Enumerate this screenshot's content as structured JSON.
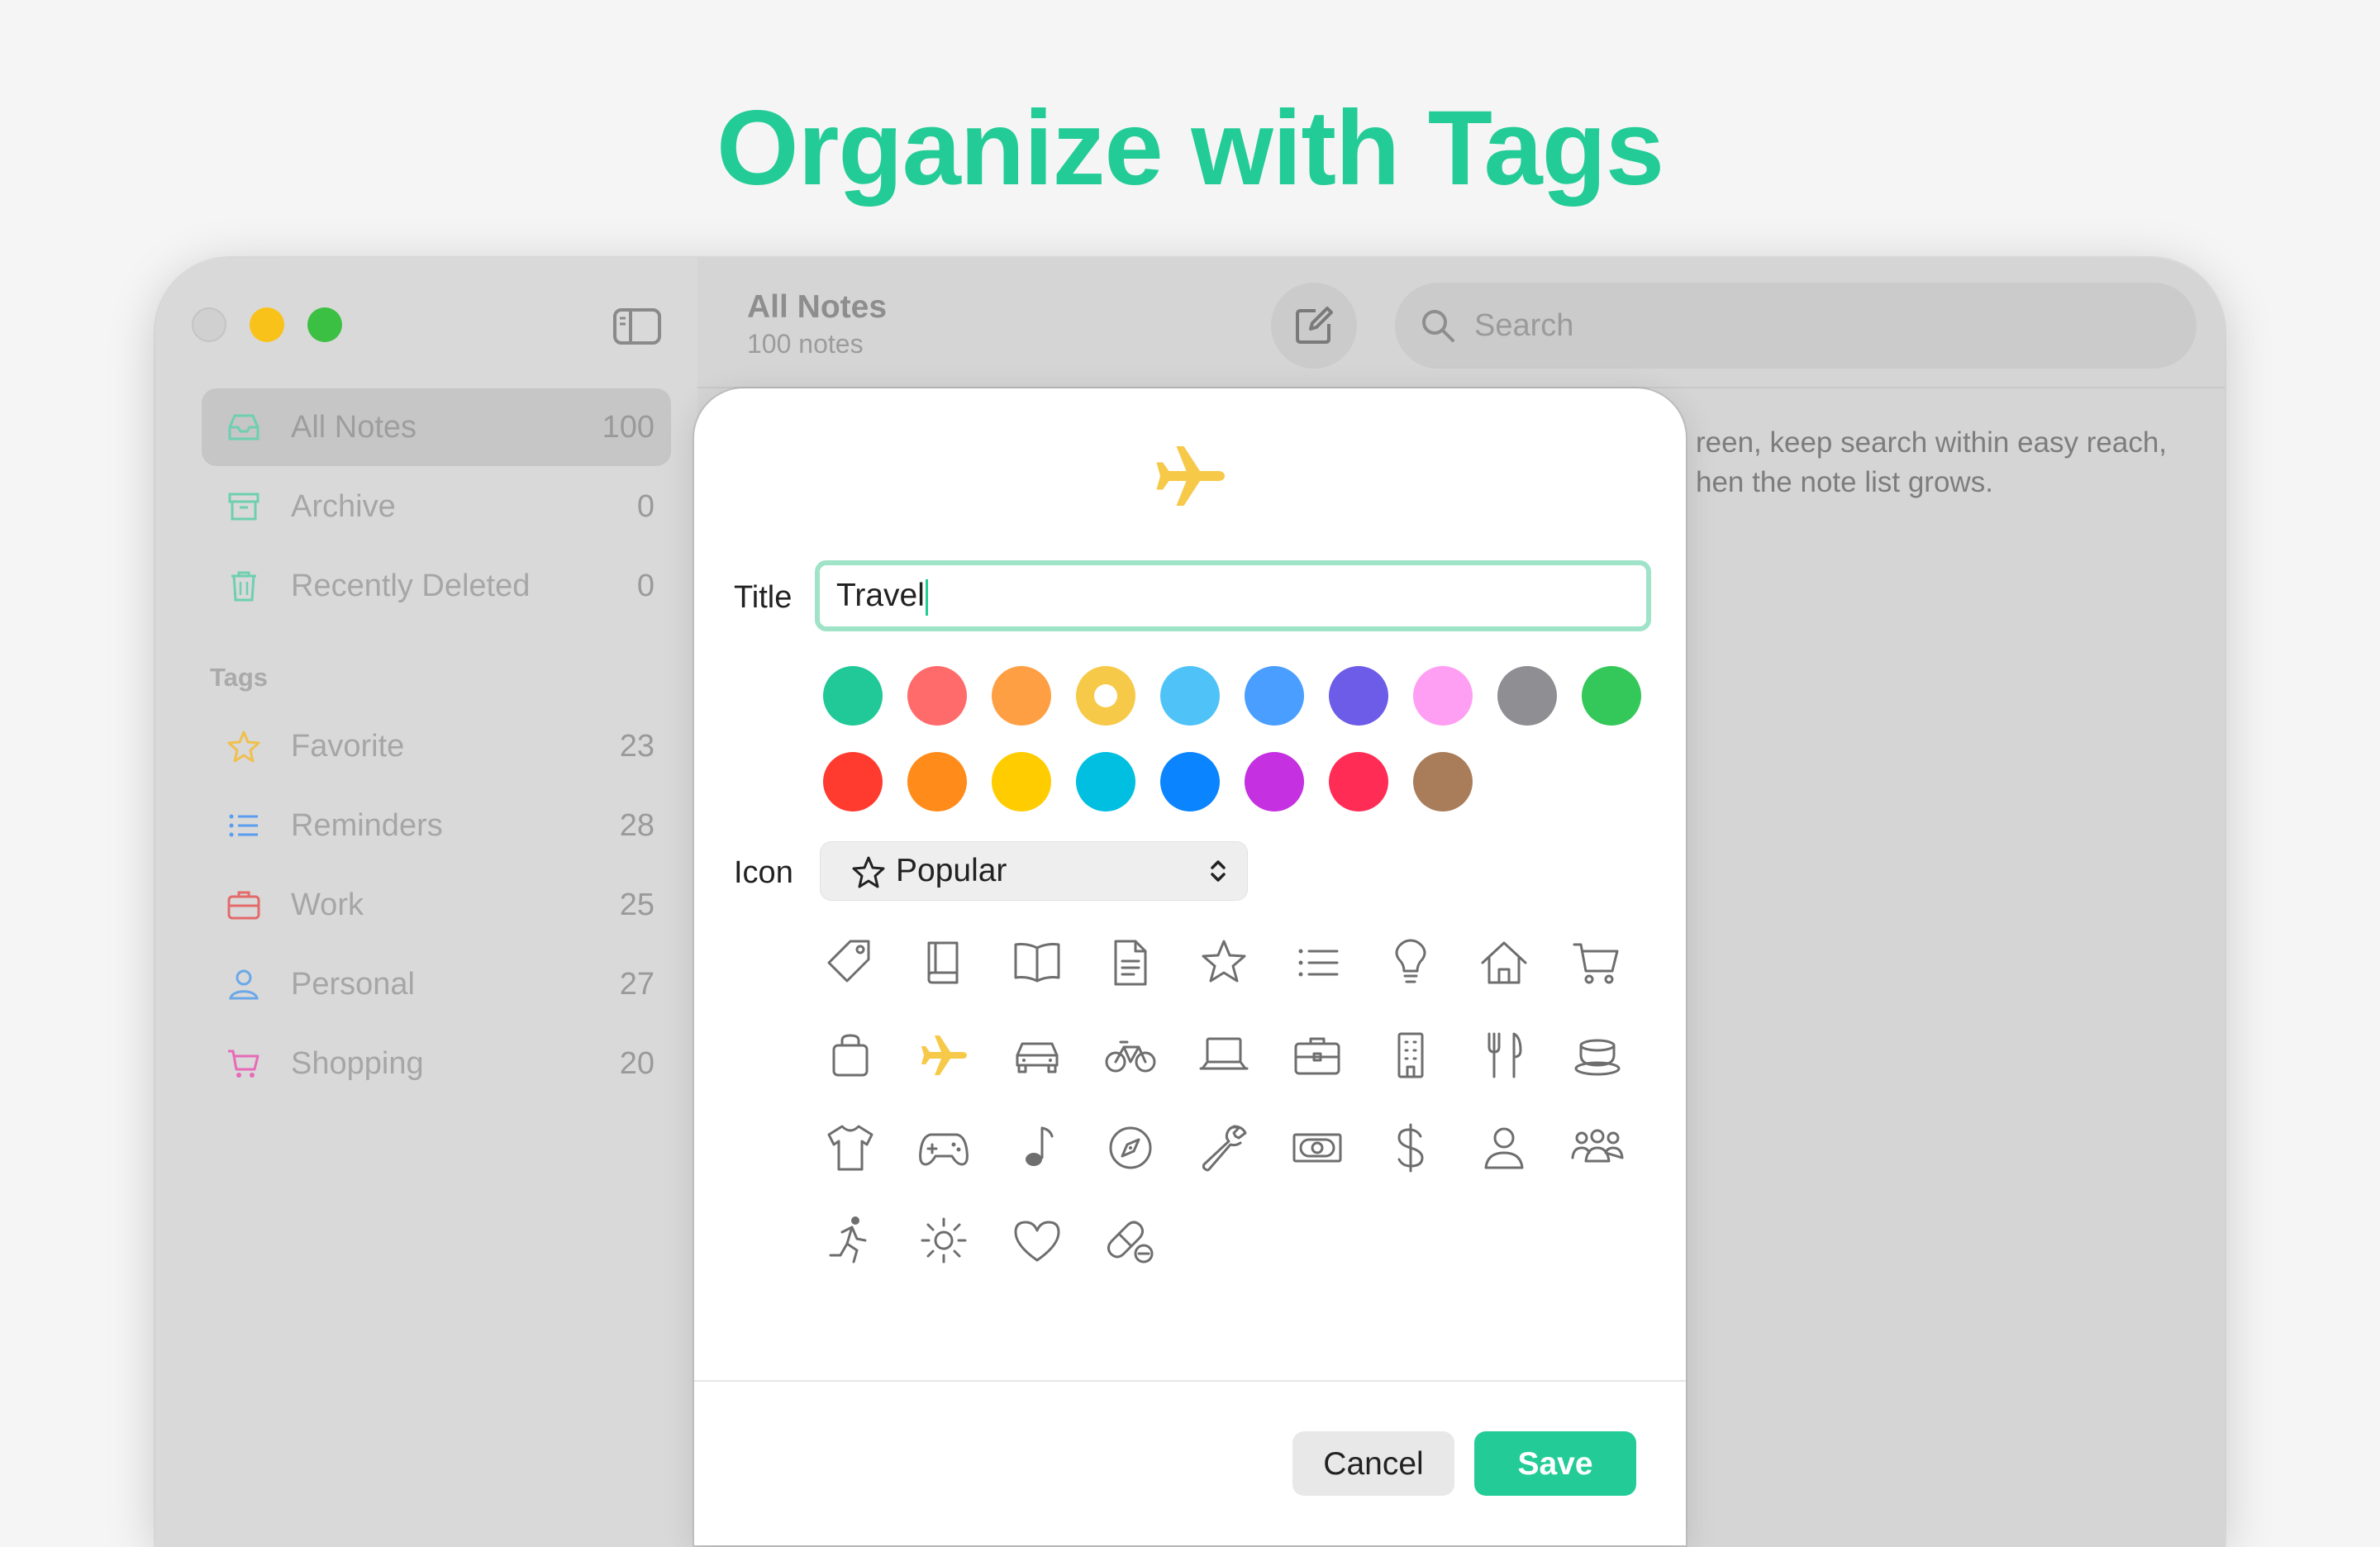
{
  "headline": "Organize with Tags",
  "sidebar": {
    "items": [
      {
        "label": "All Notes",
        "count": "100",
        "icon": "tray-icon"
      },
      {
        "label": "Archive",
        "count": "0",
        "icon": "archive-box-icon"
      },
      {
        "label": "Recently Deleted",
        "count": "0",
        "icon": "trash-icon"
      }
    ],
    "tags_header": "Tags",
    "tags": [
      {
        "label": "Favorite",
        "count": "23",
        "icon": "star-icon",
        "color": "#f0c04e"
      },
      {
        "label": "Reminders",
        "count": "28",
        "icon": "list-icon",
        "color": "#5a9df0"
      },
      {
        "label": "Work",
        "count": "25",
        "icon": "briefcase-icon",
        "color": "#e46a6a"
      },
      {
        "label": "Personal",
        "count": "27",
        "icon": "person-icon",
        "color": "#6aa8e8"
      },
      {
        "label": "Shopping",
        "count": "20",
        "icon": "cart-icon",
        "color": "#e86ab8"
      }
    ]
  },
  "main": {
    "title": "All Notes",
    "subtitle": "100 notes",
    "search_placeholder": "Search",
    "snippet_line1": "reen, keep search within easy reach,",
    "snippet_line2": "hen the note list grows."
  },
  "dialog": {
    "title_label": "Title",
    "title_value": "Travel",
    "icon_label": "Icon",
    "icon_category": "Popular",
    "selected_color": "#f7c948",
    "colors_row1": [
      "#20c997",
      "#ff6b6b",
      "#ff9f43",
      "#f7c948",
      "#4fc3f7",
      "#4a9eff",
      "#6c5ce7",
      "#ff9ff3",
      "#8e8e93",
      "#34c759"
    ],
    "colors_row2": [
      "#ff3b30",
      "#ff8c1a",
      "#ffcc00",
      "#00bfe0",
      "#0a84ff",
      "#c530e0",
      "#ff2d55",
      "#a97d5a"
    ],
    "icons": [
      "tag-icon",
      "book-icon",
      "open-book-icon",
      "document-icon",
      "star-icon",
      "list-icon",
      "lightbulb-icon",
      "house-icon",
      "cart-icon",
      "bag-icon",
      "airplane-icon",
      "car-icon",
      "bicycle-icon",
      "laptop-icon",
      "briefcase-icon",
      "building-icon",
      "fork-knife-icon",
      "cup-icon",
      "tshirt-icon",
      "gamepad-icon",
      "music-note-icon",
      "compass-icon",
      "wrench-icon",
      "banknote-icon",
      "dollar-icon",
      "person-icon",
      "group-icon",
      "runner-icon",
      "sun-icon",
      "heart-icon",
      "pill-icon"
    ],
    "selected_icon": "airplane-icon",
    "cancel_label": "Cancel",
    "save_label": "Save"
  }
}
